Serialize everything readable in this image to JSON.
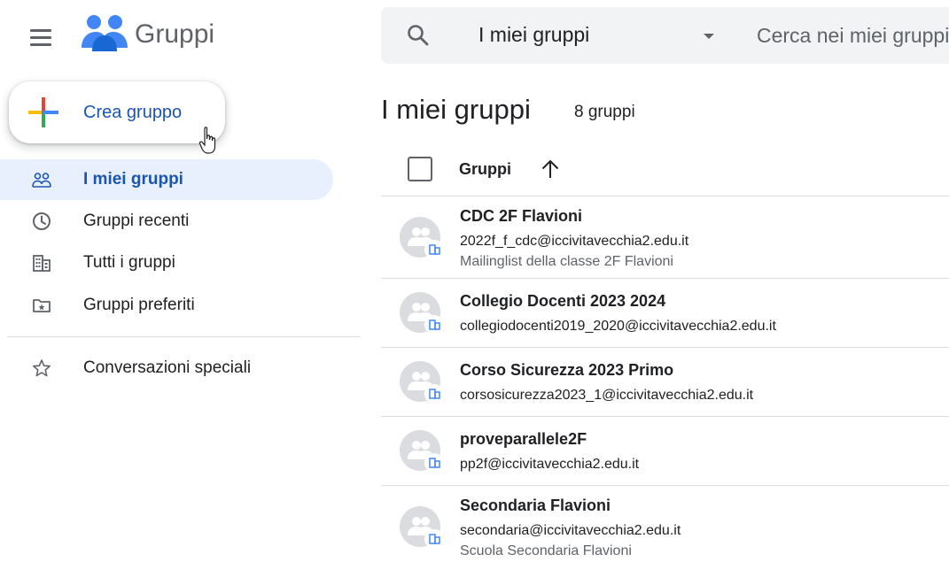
{
  "app": {
    "title": "Gruppi"
  },
  "search": {
    "scope": "I miei gruppi",
    "placeholder": "Cerca nei miei gruppi"
  },
  "create_button": {
    "label": "Crea gruppo"
  },
  "sidebar": {
    "items": [
      {
        "label": "I miei gruppi",
        "icon": "groups-icon",
        "active": true
      },
      {
        "label": "Gruppi recenti",
        "icon": "clock-icon",
        "active": false
      },
      {
        "label": "Tutti i gruppi",
        "icon": "building-icon",
        "active": false
      },
      {
        "label": "Gruppi preferiti",
        "icon": "starred-folder-icon",
        "active": false
      },
      {
        "label": "Conversazioni speciali",
        "icon": "star-icon",
        "active": false
      }
    ]
  },
  "main": {
    "title": "I miei gruppi",
    "count": "8 gruppi",
    "column_header": "Gruppi",
    "groups": [
      {
        "name": "CDC 2F Flavioni",
        "email": "2022f_f_cdc@iccivitavecchia2.edu.it",
        "description": "Mailinglist della classe 2F Flavioni"
      },
      {
        "name": "Collegio Docenti 2023 2024",
        "email": "collegiodocenti2019_2020@iccivitavecchia2.edu.it",
        "description": ""
      },
      {
        "name": "Corso Sicurezza 2023 Primo",
        "email": "corsosicurezza2023_1@iccivitavecchia2.edu.it",
        "description": ""
      },
      {
        "name": "proveparallele2F",
        "email": "pp2f@iccivitavecchia2.edu.it",
        "description": ""
      },
      {
        "name": "Secondaria Flavioni",
        "email": "secondaria@iccivitavecchia2.edu.it",
        "description": "Scuola Secondaria Flavioni"
      }
    ]
  },
  "colors": {
    "accent": "#1a56b0",
    "active_bg": "#e8f0fe",
    "search_bg": "#f1f3f4",
    "logo_blue": "#4285f4"
  }
}
